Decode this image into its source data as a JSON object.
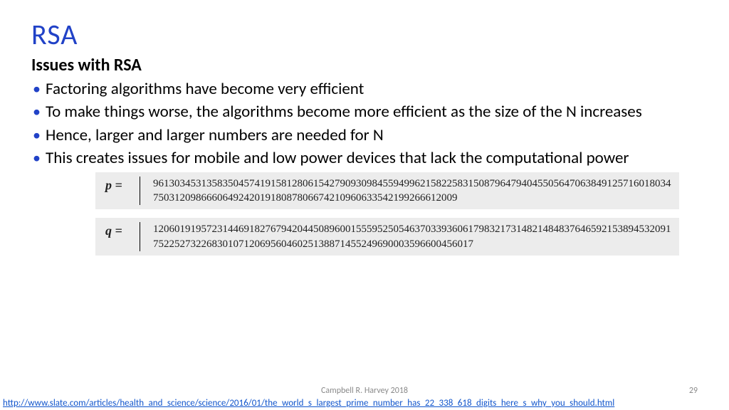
{
  "title": "RSA",
  "subtitle": "Issues with RSA",
  "bullets": [
    "Factoring algorithms have become very efficient",
    "To make things worse, the algorithms become more efficient as the size of the N increases",
    "Hence, larger and larger numbers are needed for N",
    "This creates issues for mobile and low power devices that lack the computational power"
  ],
  "p_label": "p =",
  "p_value": "9613034531358350457419158128061542790930984559499621582258315087964794045505647063849125716018034750312098666064924201918087806674210960633542199266612009",
  "q_label": "q =",
  "q_value": "1206019195723144691827679420445089600155595250546370339360617983217314821484837646592153894532091752252732268301071206956046025138871455249690003596600456017",
  "footer": "Campbell R. Harvey 2018",
  "page": "29",
  "link": "http://www.slate.com/articles/health_and_science/science/2016/01/the_world_s_largest_prime_number_has_22_338_618_digits_here_s_why_you_should.html"
}
